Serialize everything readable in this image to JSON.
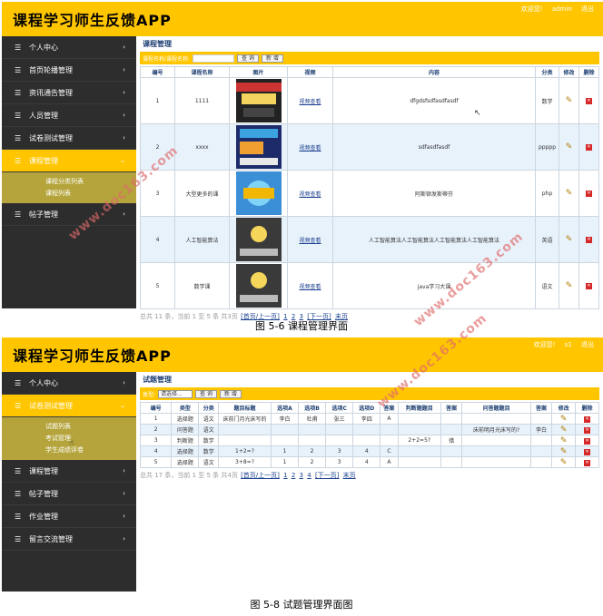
{
  "shot1": {
    "app_title": "课程学习师生反馈APP",
    "top_links": [
      "欢迎您!",
      "admin",
      "退出"
    ],
    "menu": [
      {
        "label": "个人中心",
        "arrow": "›"
      },
      {
        "label": "首页轮播管理",
        "arrow": "›"
      },
      {
        "label": "资讯通告管理",
        "arrow": "›"
      },
      {
        "label": "人员管理",
        "arrow": "›"
      },
      {
        "label": "试卷测试管理",
        "arrow": "›"
      },
      {
        "label": "课程管理",
        "arrow": "⌄"
      },
      {
        "label": "帖子管理",
        "arrow": "›"
      }
    ],
    "submenu": [
      "课程分类列表",
      "课程列表"
    ],
    "page_title": "课程管理",
    "search_label": "课程名称/课程名称:",
    "search_btn": "查 询",
    "add_btn": "新 增",
    "columns": [
      "编号",
      "课程名称",
      "图片",
      "视频",
      "内容",
      "分类",
      "修改",
      "删除"
    ],
    "rows": [
      {
        "id": "1",
        "name": "1111",
        "video": "视频查看",
        "content": "dfgdsfsdfasdfasdf",
        "category": "数学"
      },
      {
        "id": "2",
        "name": "xxxx",
        "video": "视频查看",
        "content": "sdfasdfasdf",
        "category": "ppppp"
      },
      {
        "id": "3",
        "name": "大型更多的课",
        "video": "视频查看",
        "content": "阿斯顿发斯蒂芬",
        "category": "php"
      },
      {
        "id": "4",
        "name": "人工智能算法",
        "video": "视频查看",
        "content": "人工智能算法人工智能算法人工智能算法人工智能算法",
        "category": "英语"
      },
      {
        "id": "5",
        "name": "数学课",
        "video": "视频查看",
        "content": "java学习大课",
        "category": "语文"
      }
    ],
    "pager": {
      "summary": "总共 11 条，当前 1 至 5 条 共3页",
      "nav": "[首页/上一页]",
      "p1": "1",
      "p2": "2",
      "p3": "3",
      "next": "[下一页]",
      "last": "末页"
    }
  },
  "caption1": "图 5-6 课程管理界面",
  "shot2": {
    "app_title": "课程学习师生反馈APP",
    "top_links": [
      "欢迎您!",
      "s1",
      "退出"
    ],
    "menu": [
      {
        "label": "个人中心",
        "arrow": "›"
      },
      {
        "label": "试卷测试管理",
        "arrow": "⌄"
      },
      {
        "label": "课程管理",
        "arrow": "›"
      },
      {
        "label": "帖子管理",
        "arrow": "›"
      },
      {
        "label": "作业管理",
        "arrow": "›"
      },
      {
        "label": "留言交流管理",
        "arrow": "›"
      }
    ],
    "submenu": [
      "试题列表",
      "考试管理",
      "学生成绩评卷"
    ],
    "page_title": "试题管理",
    "type_label": "类型:",
    "type_select": "请选择...",
    "search_btn": "查 询",
    "add_btn": "新 增",
    "columns": [
      "编号",
      "类型",
      "分类",
      "题目标题",
      "选项A",
      "选项B",
      "选项C",
      "选项D",
      "答案",
      "判断题题目",
      "答案",
      "问答题题目",
      "答案",
      "修改",
      "删除"
    ],
    "rows": [
      [
        "1",
        "选择题",
        "语文",
        "床前门月光床写的",
        "李白",
        "杜甫",
        "张三",
        "李四",
        "A",
        "",
        "",
        "",
        "",
        ""
      ],
      [
        "2",
        "问答题",
        "语文",
        "",
        "",
        "",
        "",
        "",
        "",
        "",
        "",
        "床前明月光床写的?",
        "李白",
        ""
      ],
      [
        "3",
        "判断题",
        "数学",
        "",
        "",
        "",
        "",
        "",
        "",
        "2+2=5?",
        "错",
        "",
        "",
        ""
      ],
      [
        "4",
        "选择题",
        "数学",
        "1+2=?",
        "1",
        "2",
        "3",
        "4",
        "C",
        "",
        "",
        "",
        "",
        ""
      ],
      [
        "5",
        "选择题",
        "语文",
        "3+8=?",
        "1",
        "2",
        "3",
        "4",
        "A",
        "",
        "",
        "",
        "",
        ""
      ]
    ],
    "pager": {
      "summary": "总共 17 条，当前 1 至 5 条 共4页",
      "nav": "[首页/上一页]",
      "p1": "1",
      "p2": "2",
      "p3": "3",
      "p4": "4",
      "next": "[下一页]",
      "last": "末页"
    }
  },
  "caption2": "图 5-8 试题管理界面图",
  "watermark": "www.doc163.com",
  "colors": {
    "topbar": "#ffc600",
    "sidebar": "#2d2d2d",
    "submenu": "#b4a43b",
    "link": "#1a3f8f"
  }
}
